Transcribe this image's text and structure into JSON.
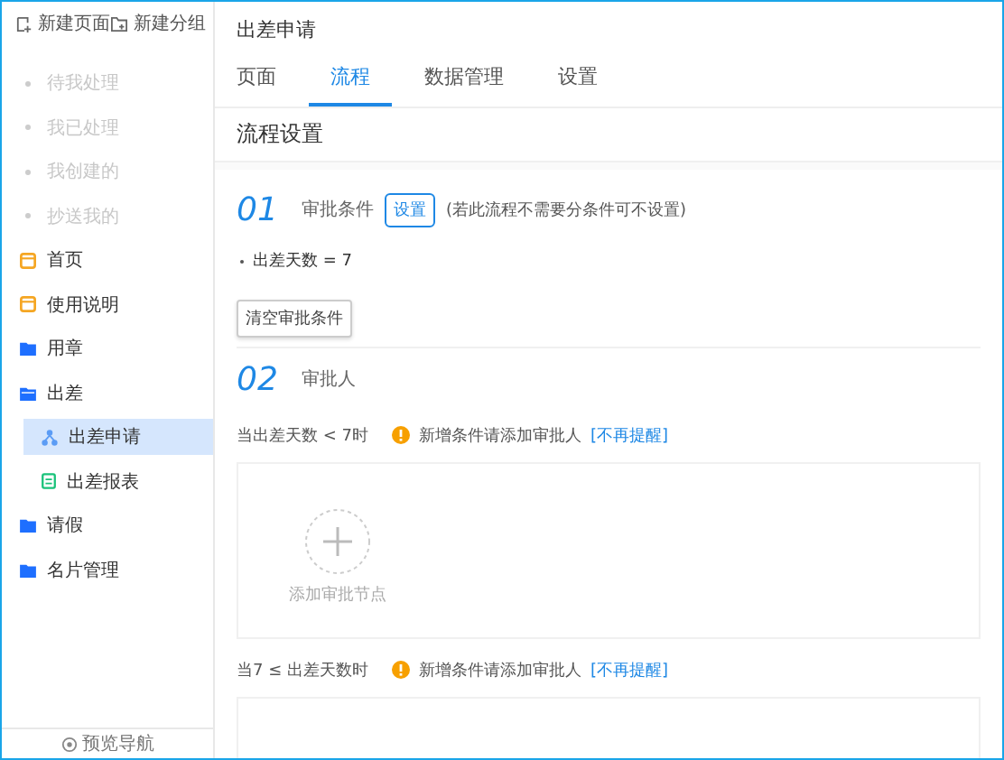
{
  "sidebar": {
    "actions": [
      {
        "kind": "new-page",
        "label": "新建页面"
      },
      {
        "kind": "new-group",
        "label": "新建分组"
      }
    ],
    "items": [
      {
        "kind": "filter",
        "label": "待我处理",
        "selected": false
      },
      {
        "kind": "filter",
        "label": "我已处理",
        "selected": false
      },
      {
        "kind": "filter",
        "label": "我创建的",
        "selected": false
      },
      {
        "kind": "filter",
        "label": "抄送我的",
        "selected": false
      },
      {
        "kind": "page",
        "label": "首页",
        "selected": false
      },
      {
        "kind": "page",
        "label": "使用说明",
        "selected": false
      },
      {
        "kind": "folder",
        "label": "用章",
        "selected": false,
        "expanded": false
      },
      {
        "kind": "folder",
        "label": "出差",
        "selected": false,
        "expanded": true,
        "children": [
          {
            "kind": "flow",
            "label": "出差申请",
            "selected": true
          },
          {
            "kind": "report",
            "label": "出差报表",
            "selected": false
          }
        ]
      },
      {
        "kind": "folder",
        "label": "请假",
        "selected": false,
        "expanded": false
      },
      {
        "kind": "folder",
        "label": "名片管理",
        "selected": false,
        "expanded": false
      }
    ],
    "footer": "预览导航"
  },
  "header": {
    "title": "出差申请"
  },
  "tabs": [
    {
      "label": "页面",
      "selected": false
    },
    {
      "label": "流程",
      "selected": true
    },
    {
      "label": "数据管理",
      "selected": false
    },
    {
      "label": "设置",
      "selected": false
    }
  ],
  "section_title": "流程设置",
  "step1": {
    "number": "01",
    "title": "审批条件",
    "button": "设置",
    "hint": "(若此流程不需要分条件可不设置)",
    "conditions": [
      "出差天数 = 7"
    ],
    "clear_button": "清空审批条件"
  },
  "step2": {
    "number": "02",
    "title": "审批人",
    "branches": [
      {
        "condition": "当出差天数 < 7时",
        "warning": "新增条件请添加审批人",
        "link": "[不再提醒]",
        "add_label": "添加审批节点"
      },
      {
        "condition": "当7 ≤ 出差天数时",
        "warning": "新增条件请添加审批人",
        "link": "[不再提醒]"
      }
    ]
  }
}
